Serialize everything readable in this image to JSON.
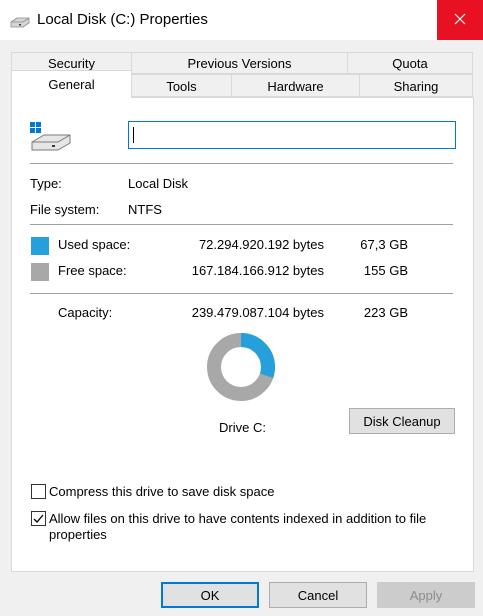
{
  "window": {
    "title": "Local Disk (C:) Properties",
    "close_icon": "close-icon",
    "drive_icon": "drive-icon"
  },
  "tabs": {
    "row1": [
      "Security",
      "Previous Versions",
      "Quota"
    ],
    "row2": [
      "General",
      "Tools",
      "Hardware",
      "Sharing"
    ],
    "active": "General"
  },
  "general": {
    "name_value": "",
    "type_label": "Type:",
    "type_value": "Local Disk",
    "fs_label": "File system:",
    "fs_value": "NTFS",
    "used": {
      "label": "Used space:",
      "bytes": "72.294.920.192 bytes",
      "short": "67,3 GB",
      "color": "#26a0da"
    },
    "free": {
      "label": "Free space:",
      "bytes": "167.184.166.912 bytes",
      "short": "155 GB",
      "color": "#a8a8a8"
    },
    "capacity": {
      "label": "Capacity:",
      "bytes": "239.479.087.104 bytes",
      "short": "223 GB"
    },
    "used_fraction": 0.302,
    "drive_label": "Drive C:",
    "cleanup_button": "Disk Cleanup",
    "compress_label": "Compress this drive to save disk space",
    "compress_checked": false,
    "index_label": "Allow files on this drive to have contents indexed in addition to file properties",
    "index_checked": true
  },
  "buttons": {
    "ok": "OK",
    "cancel": "Cancel",
    "apply": "Apply"
  }
}
